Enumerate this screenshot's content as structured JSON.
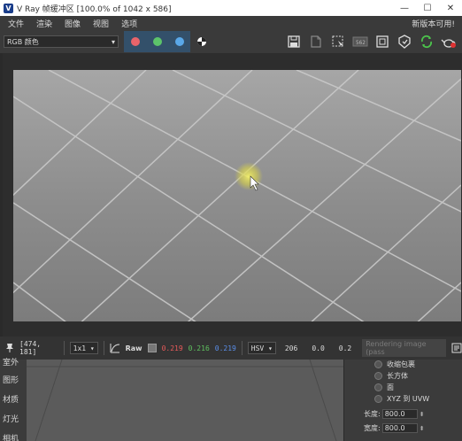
{
  "window": {
    "logo": "V",
    "title": "V Ray 帧缓冲区 [100.0% of 1042 x 586]",
    "minimize": "—",
    "maximize": "☐",
    "close": "✕"
  },
  "menu": {
    "items": [
      "文件",
      "渲染",
      "图像",
      "视图",
      "选项"
    ],
    "update_notice": "新版本可用!"
  },
  "toolbar": {
    "channel_select": "RGB 颜色",
    "channel_colors": {
      "red": "#e8646a",
      "green": "#5cc46a",
      "blue": "#5aa8e8"
    },
    "icons": [
      "save-icon",
      "save-all-icon",
      "region-render-icon",
      "history-icon",
      "track-mouse-icon",
      "render-icon",
      "interactive-render-icon",
      "refresh-icon",
      "teapot-render-icon"
    ]
  },
  "status": {
    "cursor_coords": "[474, 181]",
    "zoom_combo": "1x1",
    "raw_label": "Raw",
    "r_value": "0.219",
    "g_value": "0.216",
    "b_value": "0.219",
    "mode_combo": "HSV",
    "h_value": "206",
    "s_value": "0.0",
    "v_value": "0.2",
    "message": "Rendering image (pass"
  },
  "left_panel": {
    "labels": [
      "室外",
      "图形",
      "材质",
      "灯光",
      "相机"
    ]
  },
  "right_panel": {
    "radio_options": [
      "收缩包裹",
      "长方体",
      "面",
      "XYZ 到 UVW"
    ],
    "length_label": "长度:",
    "length_value": "800.0",
    "width_label": "宽度:",
    "width_value": "800.0"
  }
}
